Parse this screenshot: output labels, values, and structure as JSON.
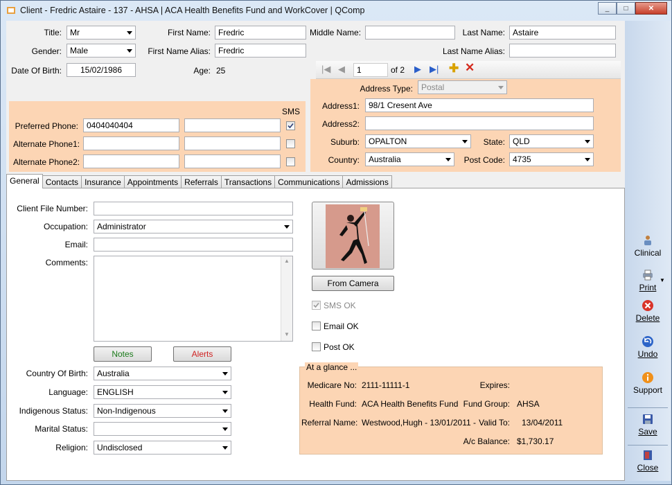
{
  "window": {
    "title": "Client - Fredric Astaire - 137 - AHSA | ACA Health Benefits Fund and WorkCover | QComp",
    "min": "_",
    "max": "□",
    "close": "✕"
  },
  "personal": {
    "title_label": "Title:",
    "title_value": "Mr",
    "first_name_label": "First Name:",
    "first_name": "Fredric",
    "middle_name_label": "Middle Name:",
    "middle_name": "",
    "last_name_label": "Last Name:",
    "last_name": "Astaire",
    "gender_label": "Gender:",
    "gender": "Male",
    "first_alias_label": "First Name Alias:",
    "first_alias": "Fredric",
    "last_alias_label": "Last Name Alias:",
    "last_alias": "",
    "dob_label": "Date Of Birth:",
    "dob": "15/02/1986",
    "age_label": "Age:",
    "age": "25"
  },
  "phones": {
    "sms_label": "SMS",
    "rows": [
      {
        "label": "Preferred Phone:",
        "value": "0404040404",
        "second": "",
        "sms": true
      },
      {
        "label": "Alternate Phone1:",
        "value": "",
        "second": "",
        "sms": false
      },
      {
        "label": "Alternate Phone2:",
        "value": "",
        "second": "",
        "sms": false
      }
    ]
  },
  "address": {
    "nav_position": "1",
    "nav_of": "of 2",
    "type_label": "Address  Type:",
    "type_value": "Postal",
    "addr1_label": "Address1:",
    "addr1": "98/1 Cresent Ave",
    "addr2_label": "Address2:",
    "addr2": "",
    "suburb_label": "Suburb:",
    "suburb": "OPALTON",
    "state_label": "State:",
    "state": "QLD",
    "country_label": "Country:",
    "country": "Australia",
    "postcode_label": "Post Code:",
    "postcode": "4735"
  },
  "tabs": [
    "General",
    "Contacts",
    "Insurance",
    "Appointments",
    "Referrals",
    "Transactions",
    "Communications",
    "Admissions"
  ],
  "general": {
    "file_label": "Client File Number:",
    "file": "",
    "occupation_label": "Occupation:",
    "occupation": "Administrator",
    "email_label": "Email:",
    "email": "",
    "comments_label": "Comments:",
    "comments": "",
    "notes_btn": "Notes",
    "alerts_btn": "Alerts",
    "cob_label": "Country Of Birth:",
    "cob": "Australia",
    "language_label": "Language:",
    "language": "ENGLISH",
    "indigenous_label": "Indigenous Status:",
    "indigenous": "Non-Indigenous",
    "marital_label": "Marital Status:",
    "marital": "",
    "religion_label": "Religion:",
    "religion": "Undisclosed",
    "camera_btn": "From Camera",
    "sms_ok": "SMS OK",
    "email_ok": "Email OK",
    "post_ok": "Post OK"
  },
  "glance": {
    "legend": "At a glance ...",
    "medicare_label": "Medicare No:",
    "medicare": "2111-11111-1",
    "expires_label": "Expires:",
    "expires": "",
    "fund_label": "Health Fund:",
    "fund": "ACA Health Benefits Fund",
    "group_label": "Fund Group:",
    "group": "AHSA",
    "referral_label": "Referral Name:",
    "referral": "Westwood,Hugh - 13/01/2011 - TE",
    "valid_label": "Valid To:",
    "valid": "13/04/2011",
    "balance_label": "A/c Balance:",
    "balance": "$1,730.17"
  },
  "sidebar": {
    "clinical": "Clinical",
    "print": "Print",
    "delete": "Delete",
    "undo": "Undo",
    "support": "Support",
    "save": "Save",
    "close": "Close"
  },
  "colors": {
    "peach": "#fcd5b4",
    "notes_text": "#1a7a1a",
    "alerts_text": "#d02020"
  }
}
